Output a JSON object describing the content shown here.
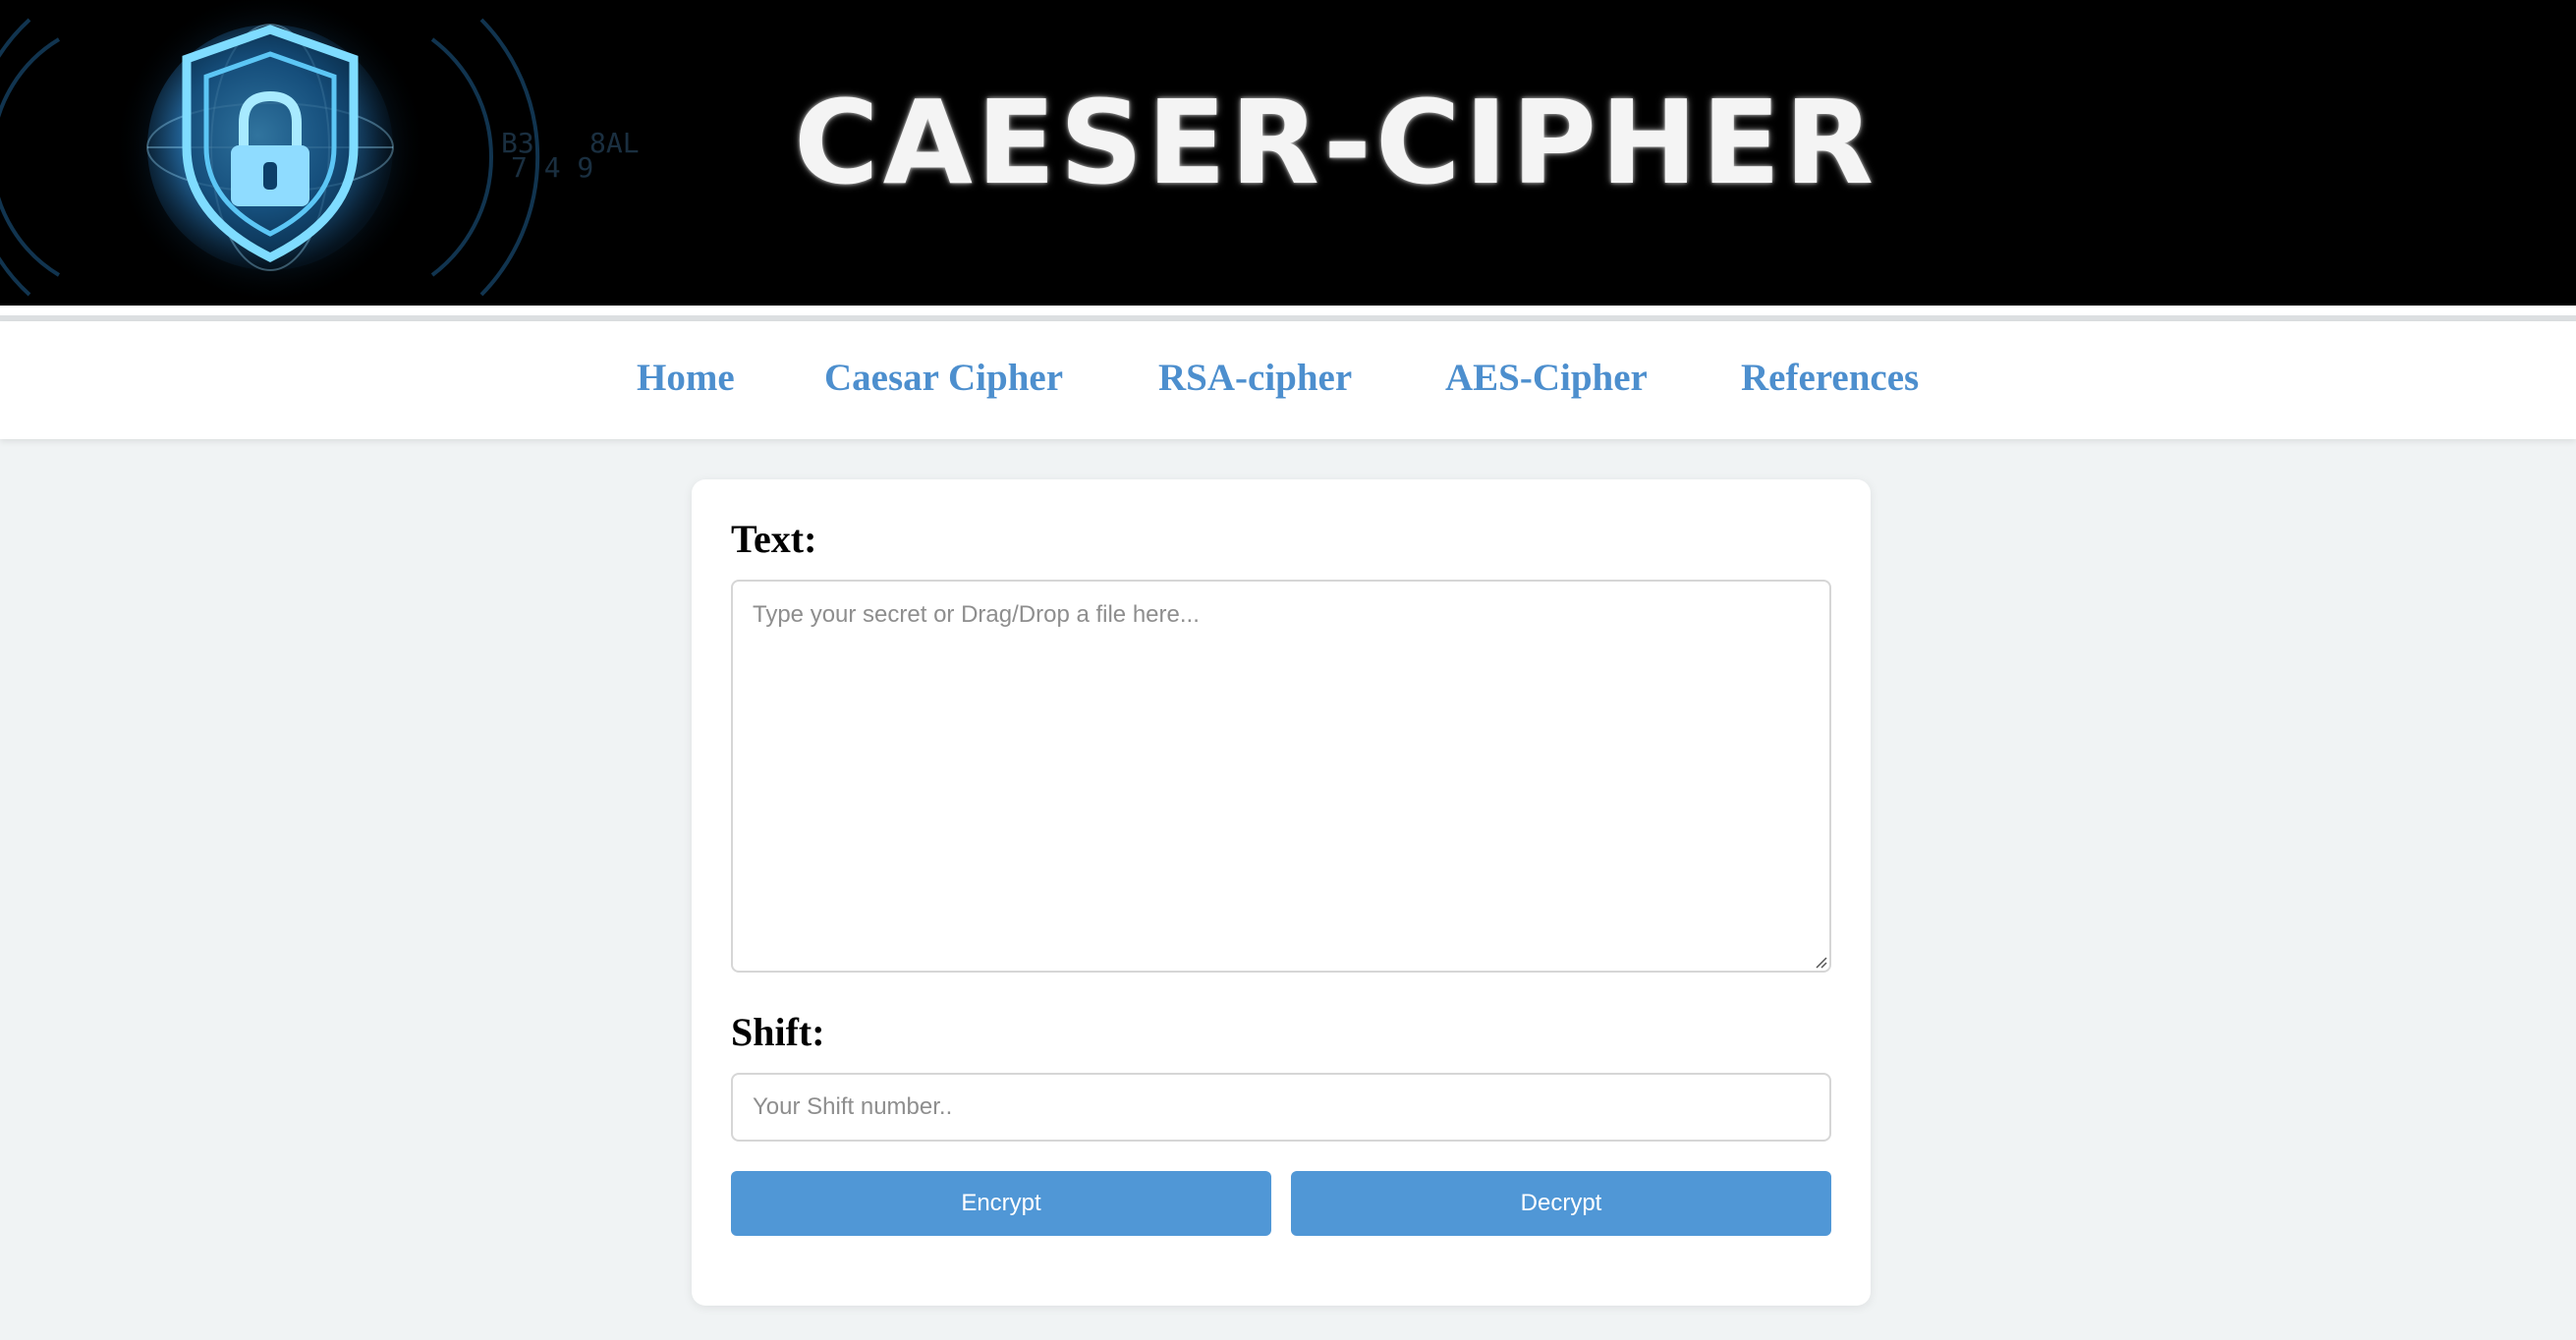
{
  "banner": {
    "title": "CAESER-CIPHER",
    "logo_icon": "shield-lock-icon",
    "accent_color": "#4fc3f7"
  },
  "nav": {
    "items": [
      {
        "label": "Home"
      },
      {
        "label": "Caesar Cipher"
      },
      {
        "label": "RSA-cipher"
      },
      {
        "label": "AES-Cipher"
      },
      {
        "label": "References"
      }
    ],
    "link_color": "#4d8fce"
  },
  "form": {
    "text_label": "Text:",
    "text_placeholder": "Type your secret or Drag/Drop a file here...",
    "text_value": "",
    "shift_label": "Shift:",
    "shift_placeholder": "Your Shift number..",
    "shift_value": "",
    "encrypt_label": "Encrypt",
    "decrypt_label": "Decrypt",
    "button_color": "#5097d6"
  }
}
